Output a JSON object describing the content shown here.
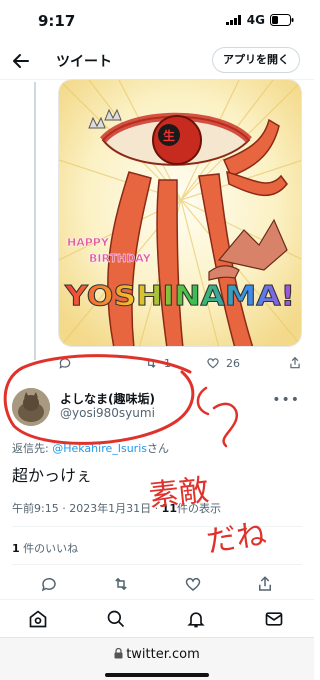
{
  "status": {
    "time": "9:17",
    "network": "4G"
  },
  "header": {
    "title": "ツイート",
    "open_app": "アプリを開く"
  },
  "image_art": {
    "line1": "HAPPY",
    "line2": "BIRTHDAY",
    "big": "YOSHINAMA!",
    "eye_char": "生",
    "colors": {
      "red": "#d83a2b",
      "flesh": "#e8663f",
      "yellow": "#f7e9a8",
      "rainbow_1": "#f23a3a",
      "rainbow_2": "#f6c22a",
      "rainbow_3": "#3bc24a",
      "rainbow_4": "#3a8ef0"
    }
  },
  "parent_actions": {
    "retweets": "1",
    "likes": "26"
  },
  "tweet": {
    "display_name": "よしなま(趣味垢)",
    "handle": "@yosi980syumi",
    "reply_prefix": "返信先: ",
    "reply_mention": "@Hekahire_Isuris",
    "reply_suffix": "さん",
    "text": "超かっけぇ",
    "time": "午前9:15 · 2023年1月31日 · ",
    "views_count": "11",
    "views_label": "件の表示",
    "likes_count": "1",
    "likes_label": "件のいいね"
  },
  "annotation": {
    "text_1": "素敵",
    "text_2": "だね",
    "ink": "#e0322b"
  },
  "url": "twitter.com",
  "icons": {
    "back": "arrow-left-icon",
    "reply": "comment-icon",
    "retweet": "retweet-icon",
    "like": "heart-icon",
    "share": "share-icon",
    "more": "more-icon",
    "home": "home-icon",
    "search": "search-icon",
    "notifications": "bell-icon",
    "messages": "mail-icon",
    "lock": "lock-icon"
  }
}
